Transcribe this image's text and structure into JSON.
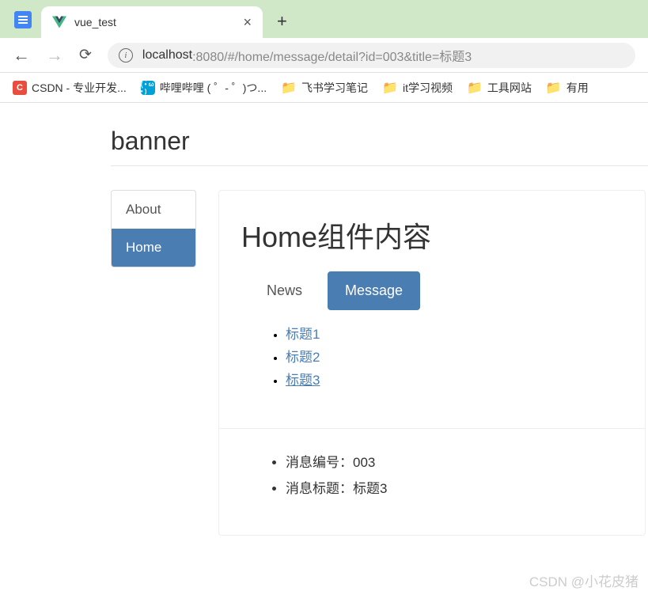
{
  "browser": {
    "tab_title": "vue_test",
    "url_host": "localhost",
    "url_path": ":8080/#/home/message/detail?id=003&title=标题3",
    "new_tab": "+",
    "close": "×"
  },
  "bookmarks": [
    {
      "label": "CSDN - 专业开发..."
    },
    {
      "label": "哔哩哔哩 ( ゜- ゜)つ..."
    },
    {
      "label": "飞书学习笔记"
    },
    {
      "label": "it学习视频"
    },
    {
      "label": "工具网站"
    },
    {
      "label": "有用"
    }
  ],
  "page": {
    "banner": "banner",
    "nav": [
      {
        "label": "About",
        "active": false
      },
      {
        "label": "Home",
        "active": true
      }
    ],
    "content_heading": "Home组件内容",
    "subtabs": [
      {
        "label": "News",
        "active": false
      },
      {
        "label": "Message",
        "active": true
      }
    ],
    "messages": [
      {
        "label": "标题1"
      },
      {
        "label": "标题2"
      },
      {
        "label": "标题3"
      }
    ],
    "detail": {
      "id_label": "消息编号：",
      "id_value": "003",
      "title_label": "消息标题：",
      "title_value": "标题3"
    }
  },
  "watermark": "CSDN @小花皮猪"
}
